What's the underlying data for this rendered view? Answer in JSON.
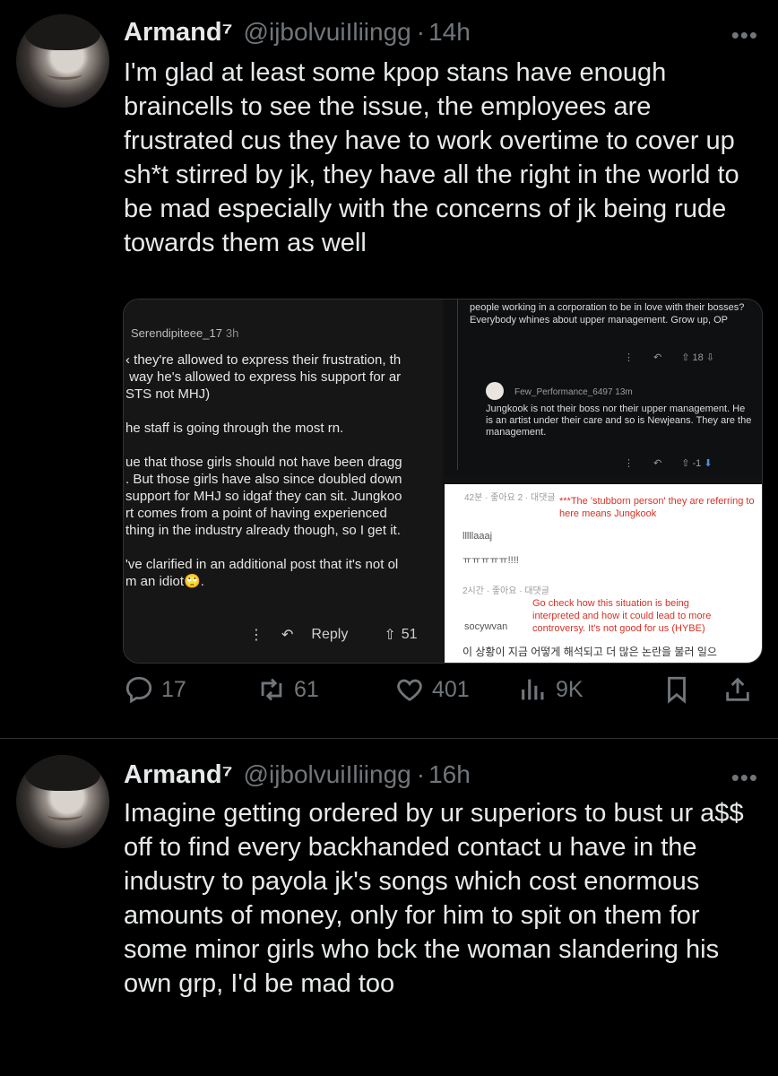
{
  "tweets": [
    {
      "name": "Armand⁷",
      "handle": "@ijbolvuiIliingg",
      "sep": "·",
      "time": "14h",
      "more": "•••",
      "text": "I'm glad at least some kpop stans have enough braincells to see the issue, the employees are frustrated cus they have to work overtime to cover up sh*t stirred by jk, they have all the right in the world to be mad especially with the concerns of jk being rude towards them as well"
    },
    {
      "name": "Armand⁷",
      "handle": "@ijbolvuiIliingg",
      "sep": "·",
      "time": "16h",
      "more": "•••",
      "text": "Imagine getting ordered by ur superiors to bust ur a$$ off to find every backhanded contact u have in the industry to payola jk's songs which cost enormous amounts of money, only for him to spit on them for some minor girls who bck the woman slandering his own grp, I'd be mad too"
    }
  ],
  "media": {
    "left": {
      "user": "Serendipiteee_17",
      "time": "3h",
      "text": "‹ they're allowed to express their frustration, th\n way he's allowed to express his support for ar\nSTS not MHJ)\n\nhe staff is going through the most rn.\n\nue that those girls should not have been dragg\n. But those girls have also since doubled down\nsupport for MHJ so idgaf they can sit. Jungkoo\nrt comes from a point of having experienced\nthing in the industry already though, so I get it.\n\n've clarified in an additional post that it's not ol\nm an idiot🙄.",
      "reply": "Reply",
      "votes": "51"
    },
    "right_top": {
      "text1": "people working in a corporation to be in love with their bosses? Everybody whines about upper management. Grow up, OP",
      "votes1": "18",
      "user2": "Few_Performance_6497",
      "time2": "13m",
      "text2": "Jungkook is not their boss nor their upper management. He is an artist under their care and so is Newjeans. They are the management.",
      "votes2": "-1"
    },
    "right_bottom": {
      "meta1": "42분 · 좋아요 2 · 대댓글",
      "red1": "***The 'stubborn person' they are referring to here means Jungkook",
      "l1": "lllllaaaj",
      "l2": "ㅠㅠㅠㅠㅠ!!!!",
      "meta2": "2시간 · 좋아요 · 대댓글",
      "red2": "Go check how this situation is being interpreted and how it could lead to more controversy. It's not good for us (HYBE)",
      "user": "socywvan",
      "korean": "이 상황이 지금 어떻게 해석되고 더 많은 논란을 불러 일으"
    }
  },
  "actions": {
    "replies": "17",
    "retweets": "61",
    "likes": "401",
    "views": "9K"
  }
}
